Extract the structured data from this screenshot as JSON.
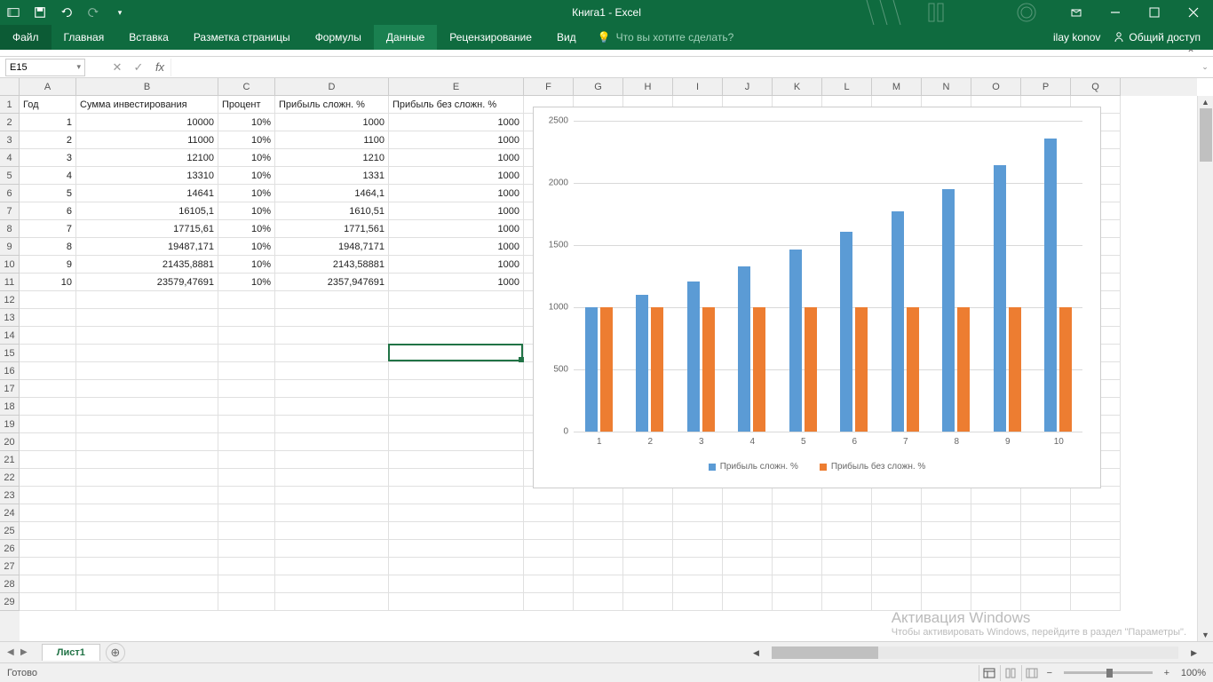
{
  "title": "Книга1 - Excel",
  "user": "ilay konov",
  "share": "Общий доступ",
  "tabs": [
    "Файл",
    "Главная",
    "Вставка",
    "Разметка страницы",
    "Формулы",
    "Данные",
    "Рецензирование",
    "Вид"
  ],
  "active_tab": "Данные",
  "tellme": "Что вы хотите сделать?",
  "name_box": "E15",
  "formula": "",
  "col_widths": {
    "A": 64,
    "B": 160,
    "C": 64,
    "D": 128,
    "E": 152,
    "rest": 56
  },
  "columns": [
    "A",
    "B",
    "C",
    "D",
    "E",
    "F",
    "G",
    "H",
    "I",
    "J",
    "K",
    "L",
    "M",
    "N",
    "O",
    "P",
    "Q"
  ],
  "rows": 29,
  "table": {
    "headers": [
      "Год",
      "Сумма инвестирования",
      "Процент",
      "Прибыль сложн. %",
      "Прибыль без сложн. %"
    ],
    "data": [
      [
        "1",
        "10000",
        "10%",
        "1000",
        "1000"
      ],
      [
        "2",
        "11000",
        "10%",
        "1100",
        "1000"
      ],
      [
        "3",
        "12100",
        "10%",
        "1210",
        "1000"
      ],
      [
        "4",
        "13310",
        "10%",
        "1331",
        "1000"
      ],
      [
        "5",
        "14641",
        "10%",
        "1464,1",
        "1000"
      ],
      [
        "6",
        "16105,1",
        "10%",
        "1610,51",
        "1000"
      ],
      [
        "7",
        "17715,61",
        "10%",
        "1771,561",
        "1000"
      ],
      [
        "8",
        "19487,171",
        "10%",
        "1948,7171",
        "1000"
      ],
      [
        "9",
        "21435,8881",
        "10%",
        "2143,58881",
        "1000"
      ],
      [
        "10",
        "23579,47691",
        "10%",
        "2357,947691",
        "1000"
      ]
    ]
  },
  "chart_data": {
    "type": "bar",
    "categories": [
      "1",
      "2",
      "3",
      "4",
      "5",
      "6",
      "7",
      "8",
      "9",
      "10"
    ],
    "series": [
      {
        "name": "Прибыль сложн. %",
        "color": "#5b9bd5",
        "values": [
          1000,
          1100,
          1210,
          1331,
          1464.1,
          1610.51,
          1771.561,
          1948.7171,
          2143.58881,
          2357.947691
        ]
      },
      {
        "name": "Прибыль без сложн. %",
        "color": "#ed7d31",
        "values": [
          1000,
          1000,
          1000,
          1000,
          1000,
          1000,
          1000,
          1000,
          1000,
          1000
        ]
      }
    ],
    "ylim": [
      0,
      2500
    ],
    "yticks": [
      0,
      500,
      1000,
      1500,
      2000,
      2500
    ]
  },
  "sheet_name": "Лист1",
  "status": "Готово",
  "zoom": "100%",
  "watermark": {
    "t1": "Активация Windows",
    "t2": "Чтобы активировать Windows, перейдите в раздел \"Параметры\"."
  }
}
